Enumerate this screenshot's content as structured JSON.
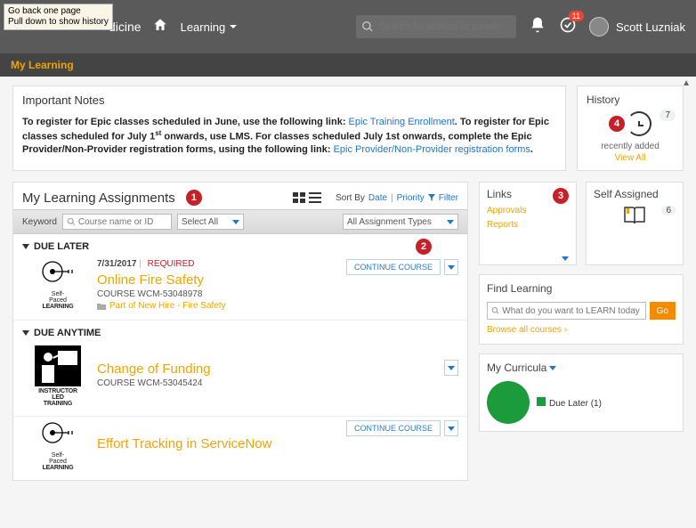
{
  "tooltip": {
    "line1": "Go back one page",
    "line2": "Pull down to show history"
  },
  "header": {
    "brand_suffix": "dicine",
    "learning_menu": "Learning",
    "search_placeholder": "Search for actions or people",
    "notif_badge": "11",
    "username": "Scott Luzniak"
  },
  "subheader": {
    "title": "My Learning"
  },
  "notes": {
    "title": "Important Notes",
    "p1a": "To register for Epic classes scheduled in June, use the following link: ",
    "p1b": "Epic Training Enrollment",
    "p1c": ". To register for Epic classes scheduled for July 1",
    "p1d": "st",
    "p1e": " onwards, use LMS. For classes scheduled July 1st onwards, complete the Epic Provider/Non-Provider registration forms, using the following link: ",
    "p1f": "Epic Provider/Non-Provider registration forms",
    "p1g": "."
  },
  "history": {
    "title": "History",
    "count": "7",
    "sub": "recently added",
    "viewall": "View All"
  },
  "markers": {
    "m1": "1",
    "m2": "2",
    "m3": "3",
    "m4": "4"
  },
  "assignments": {
    "title": "My Learning Assignments",
    "sort_prefix": "Sort By",
    "sort_date": "Date",
    "sort_priority": "Priority",
    "filter": "Filter",
    "keyword_label": "Keyword",
    "keyword_placeholder": "Course name or ID",
    "select_all": "Select All",
    "types": "All Assignment Types",
    "sections": {
      "due_later": "DUE LATER",
      "due_anytime": "DUE ANYTIME"
    },
    "icon_selfpaced_l1": "Self-",
    "icon_selfpaced_l2": "Paced",
    "icon_learning": "LEARNING",
    "icon_ilt_l1": "INSTRUCTOR",
    "icon_ilt_l2": "LED",
    "icon_ilt_l3": "TRAINING",
    "items": {
      "a": {
        "date": "7/31/2017",
        "required": "REQUIRED",
        "action": "CONTINUE COURSE",
        "title": "Online Fire Safety",
        "code": "COURSE WCM-53048978",
        "folder": "Part of New Hire - Fire Safety"
      },
      "b": {
        "title": "Change of Funding",
        "code": "COURSE WCM-53045424"
      },
      "c": {
        "action": "CONTINUE COURSE",
        "title": "Effort Tracking in ServiceNow"
      }
    }
  },
  "links": {
    "title": "Links",
    "approvals": "Approvals",
    "reports": "Reports"
  },
  "selfassigned": {
    "title": "Self Assigned",
    "count": "6"
  },
  "find": {
    "title": "Find Learning",
    "placeholder": "What do you want to LEARN today",
    "go": "Go",
    "browse": "Browse all courses"
  },
  "curricula": {
    "title": "My Curricula",
    "legend": "Due Later (1)"
  }
}
